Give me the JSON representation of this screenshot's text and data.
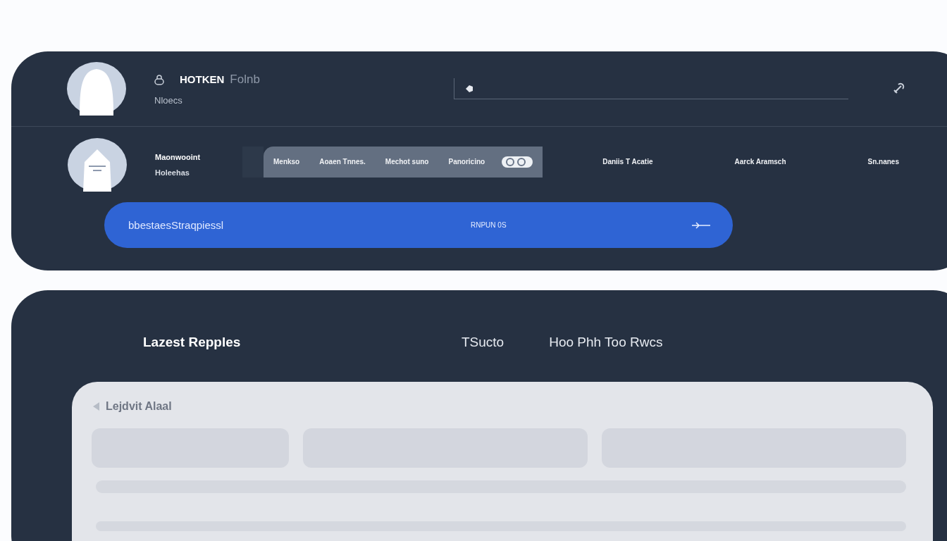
{
  "header": {
    "title": "HOTKEN",
    "title_suffix": "Folnb",
    "subtitle": "Nloecs"
  },
  "profile": {
    "name": "Maonwooint",
    "subtitle": "Holeehas"
  },
  "tabs": [
    {
      "kind": "text",
      "label": "Menkso",
      "selected": true
    },
    {
      "kind": "text",
      "label": "Aoaen Tnnes.",
      "selected": true
    },
    {
      "kind": "text",
      "label": "Mechot suno",
      "selected": true
    },
    {
      "kind": "text",
      "label": "Panoricino",
      "selected": true
    },
    {
      "kind": "icon",
      "selected": true
    },
    {
      "kind": "text",
      "label": "Daniis T Acatie",
      "selected": false
    },
    {
      "kind": "text",
      "label": "Aarck Aramsch",
      "selected": false
    },
    {
      "kind": "text",
      "label": "Sn.nanes",
      "selected": false
    }
  ],
  "banner": {
    "text": "bbestaesStraqpiessl",
    "status": "RNPUN 0S"
  },
  "section": {
    "title": "Lazest Repples",
    "links": [
      "TSucto",
      "Hoo Phh Too Rwcs"
    ]
  },
  "panel": {
    "title": "Lejdvit Alaal"
  }
}
